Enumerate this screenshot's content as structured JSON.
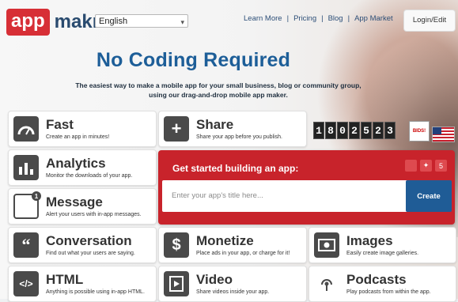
{
  "brand": {
    "logo_part1": "app",
    "logo_part2": "makr"
  },
  "header": {
    "language": "English",
    "nav": [
      "Learn More",
      "Pricing",
      "Blog",
      "App Market"
    ],
    "login": "Login/Edit"
  },
  "hero": {
    "headline": "No Coding Required",
    "subline": "The easiest way to make a mobile app for your small business, blog or community group, using our drag-and-drop mobile app maker."
  },
  "tiles": {
    "fast": {
      "title": "Fast",
      "desc": "Create an app in minutes!"
    },
    "share": {
      "title": "Share",
      "desc": "Share your app before you publish."
    },
    "analytics": {
      "title": "Analytics",
      "desc": "Monitor the downloads of your app."
    },
    "message": {
      "title": "Message",
      "desc": "Alert your users with in-app messages."
    },
    "conversation": {
      "title": "Conversation",
      "desc": "Find out what your users are saying."
    },
    "monetize": {
      "title": "Monetize",
      "desc": "Place ads in your app, or charge for it!"
    },
    "images": {
      "title": "Images",
      "desc": "Easily create image galleries."
    },
    "html": {
      "title": "HTML",
      "desc": "Anything is possible using in-app HTML."
    },
    "video": {
      "title": "Video",
      "desc": "Share videos inside your app."
    },
    "podcasts": {
      "title": "Podcasts",
      "desc": "Play podcasts from within the app."
    }
  },
  "counter": [
    "1",
    "8",
    "0",
    "2",
    "5",
    "2",
    "3"
  ],
  "badge_text": "BIDS!",
  "cta": {
    "title": "Get started building an app:",
    "placeholder": "Enter your app's title here...",
    "button": "Create"
  },
  "message_badge": "1"
}
